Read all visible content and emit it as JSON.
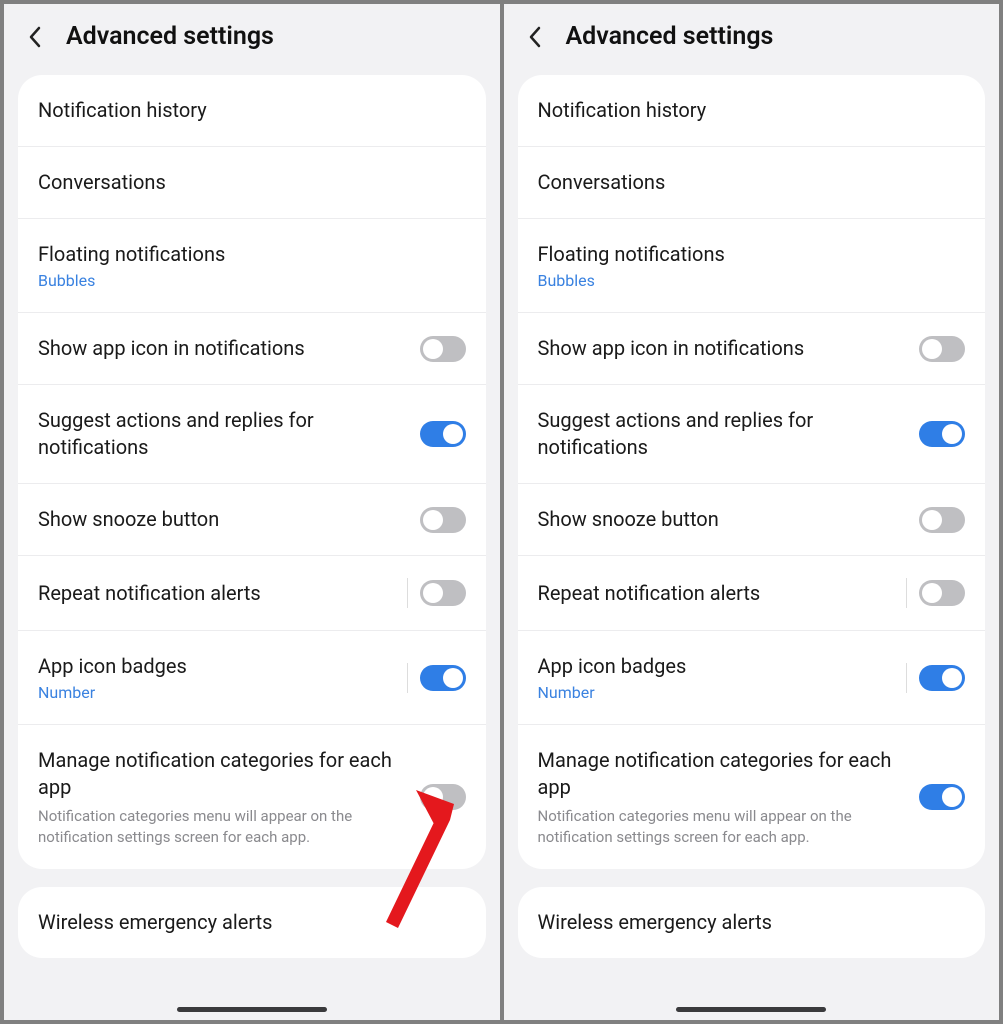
{
  "screens": [
    {
      "title": "Advanced settings",
      "groups": [
        [
          {
            "label": "Notification history"
          },
          {
            "label": "Conversations"
          },
          {
            "label": "Floating notifications",
            "sub": "Bubbles"
          },
          {
            "label": "Show app icon in notifications",
            "toggle": false
          },
          {
            "label": "Suggest actions and replies for notifications",
            "toggle": true
          },
          {
            "label": "Show snooze button",
            "toggle": false
          },
          {
            "label": "Repeat notification alerts",
            "toggle": false,
            "v_div": true
          },
          {
            "label": "App icon badges",
            "sub": "Number",
            "toggle": true,
            "v_div": true
          },
          {
            "label": "Manage notification categories for each app",
            "desc": "Notification categories menu will appear on the notification settings screen for each app.",
            "toggle": false
          }
        ],
        [
          {
            "label": "Wireless emergency alerts"
          }
        ]
      ],
      "arrow": true
    },
    {
      "title": "Advanced settings",
      "groups": [
        [
          {
            "label": "Notification history"
          },
          {
            "label": "Conversations"
          },
          {
            "label": "Floating notifications",
            "sub": "Bubbles"
          },
          {
            "label": "Show app icon in notifications",
            "toggle": false
          },
          {
            "label": "Suggest actions and replies for notifications",
            "toggle": true
          },
          {
            "label": "Show snooze button",
            "toggle": false
          },
          {
            "label": "Repeat notification alerts",
            "toggle": false,
            "v_div": true
          },
          {
            "label": "App icon badges",
            "sub": "Number",
            "toggle": true,
            "v_div": true
          },
          {
            "label": "Manage notification categories for each app",
            "desc": "Notification categories menu will appear on the notification settings screen for each app.",
            "toggle": true
          }
        ],
        [
          {
            "label": "Wireless emergency alerts"
          }
        ]
      ],
      "arrow": false
    }
  ]
}
